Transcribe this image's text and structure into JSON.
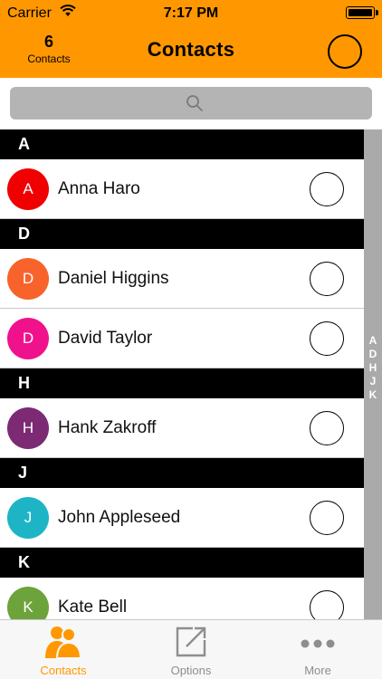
{
  "status_bar": {
    "carrier": "Carrier",
    "time": "7:17 PM"
  },
  "header": {
    "count": "6",
    "count_label": "Contacts",
    "title": "Contacts"
  },
  "search": {
    "placeholder": ""
  },
  "sections": [
    {
      "letter": "A",
      "contacts": [
        {
          "initial": "A",
          "name": "Anna Haro",
          "color": "#F00000"
        }
      ]
    },
    {
      "letter": "D",
      "contacts": [
        {
          "initial": "D",
          "name": "Daniel Higgins",
          "color": "#F7632B"
        },
        {
          "initial": "D",
          "name": "David Taylor",
          "color": "#F0128C"
        }
      ]
    },
    {
      "letter": "H",
      "contacts": [
        {
          "initial": "H",
          "name": "Hank Zakroff",
          "color": "#7B2A73"
        }
      ]
    },
    {
      "letter": "J",
      "contacts": [
        {
          "initial": "J",
          "name": "John Appleseed",
          "color": "#1DB5C6"
        }
      ]
    },
    {
      "letter": "K",
      "contacts": [
        {
          "initial": "K",
          "name": "Kate Bell",
          "color": "#6CA33A"
        }
      ]
    }
  ],
  "index": [
    "A",
    "D",
    "H",
    "J",
    "K"
  ],
  "tabs": [
    {
      "label": "Contacts",
      "icon": "contacts-icon",
      "selected": true
    },
    {
      "label": "Options",
      "icon": "options-icon",
      "selected": false
    },
    {
      "label": "More",
      "icon": "more-icon",
      "selected": false
    }
  ],
  "colors": {
    "accent": "#FF9800",
    "index_bar": "#AAAAAA",
    "tab_inactive": "#8E8E8E"
  }
}
